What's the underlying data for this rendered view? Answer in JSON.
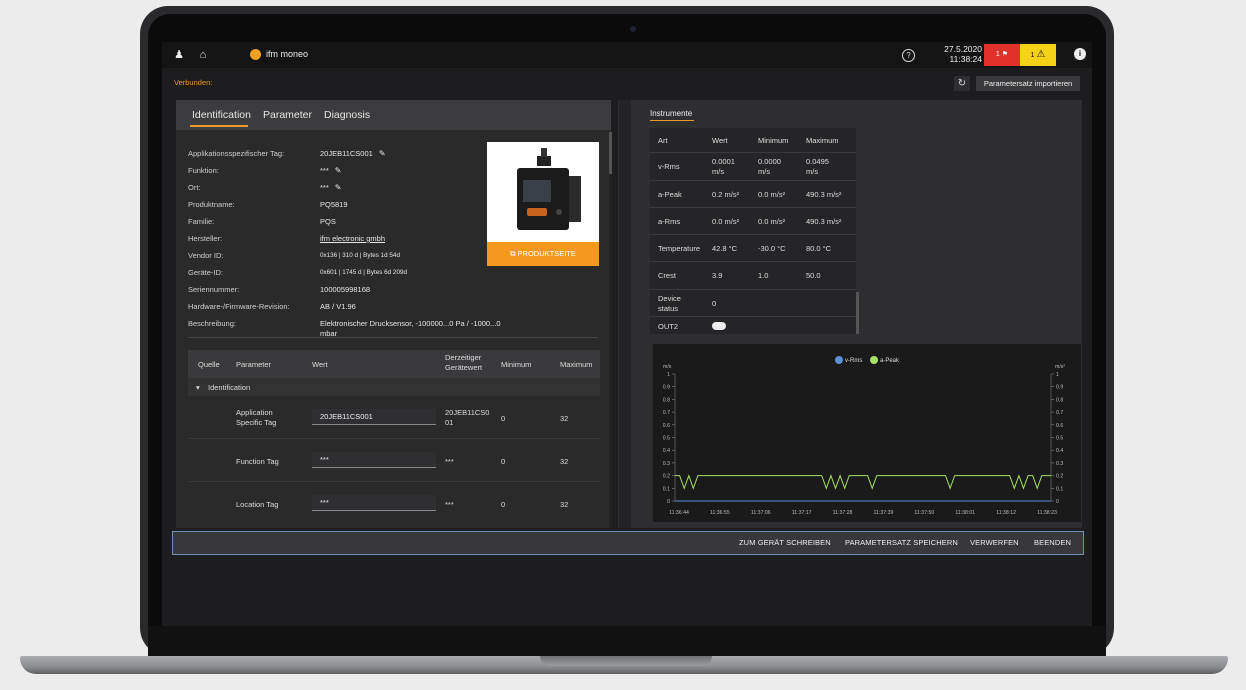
{
  "header": {
    "app_name": "ifm moneo",
    "date": "27.5.2020",
    "time": "11:38:24",
    "alarm_red_count": "1",
    "alarm_yellow_count": "1",
    "help_icon": "question-icon",
    "info_icon": "info-icon"
  },
  "status": {
    "connected": "Verbunden:",
    "import_label": "Parametersatz importieren"
  },
  "tabs": [
    "Identification",
    "Parameter",
    "Diagnosis"
  ],
  "identification": {
    "fields": [
      {
        "label": "Applikationsspezifischer Tag:",
        "value": "20JEB11CS001"
      },
      {
        "label": "Funktion:",
        "value": "***"
      },
      {
        "label": "Ort:",
        "value": "***"
      },
      {
        "label": "Produktname:",
        "value": "PQ5819"
      },
      {
        "label": "Familie:",
        "value": "PQS"
      },
      {
        "label": "Hersteller:",
        "value": "ifm electronic gmbh"
      },
      {
        "label": "Vendor ID:",
        "value": "0x136 | 310 d | Bytes 1d 54d"
      },
      {
        "label": "Geräte-ID:",
        "value": "0x601 | 1745 d | Bytes 6d 209d"
      },
      {
        "label": "Seriennummer:",
        "value": "100005998168"
      },
      {
        "label": "Hardware-/Firmware-Revision:",
        "value": "AB / V1.96"
      },
      {
        "label": "Beschreibung:",
        "value": "Elektronischer Drucksensor, -100000...0 Pa / -1000...0",
        "value2": "mbar"
      }
    ],
    "product_button": "PRODUKTSEITE"
  },
  "param_table": {
    "headers": [
      "Quelle",
      "Parameter",
      "Wert",
      "Derzeitiger",
      "Gerätewert",
      "Minimum",
      "Maximum"
    ],
    "group": "Identification",
    "rows": [
      {
        "param1": "Application",
        "param2": "Specific Tag",
        "value": "20JEB11CS001",
        "current1": "20JEB11CS0",
        "current2": "01",
        "min": "0",
        "max": "32"
      },
      {
        "param1": "Function Tag",
        "param2": "",
        "value": "***",
        "current1": "***",
        "current2": "",
        "min": "0",
        "max": "32"
      },
      {
        "param1": "Location Tag",
        "param2": "",
        "value": "***",
        "current1": "***",
        "current2": "",
        "min": "0",
        "max": "32"
      }
    ]
  },
  "instruments": {
    "title": "Instrumente",
    "headers": [
      "Art",
      "Wert",
      "Minimum",
      "Maximum"
    ],
    "rows": [
      {
        "art1": "v-Rms",
        "art2": "",
        "w1": "0.0001",
        "w2": "m/s",
        "min1": "0.0000",
        "min2": "m/s",
        "max1": "0.0495",
        "max2": "m/s"
      },
      {
        "art1": "a-Peak",
        "art2": "",
        "w1": "0.2 m/s²",
        "w2": "",
        "min1": "0.0 m/s²",
        "min2": "",
        "max1": "490.3 m/s²",
        "max2": ""
      },
      {
        "art1": "a-Rms",
        "art2": "",
        "w1": "0.0 m/s²",
        "w2": "",
        "min1": "0.0 m/s²",
        "min2": "",
        "max1": "490.3 m/s²",
        "max2": ""
      },
      {
        "art1": "Temperature",
        "art2": "",
        "w1": "42.8 °C",
        "w2": "",
        "min1": "-30.0 °C",
        "min2": "",
        "max1": "80.0 °C",
        "max2": ""
      },
      {
        "art1": "Crest",
        "art2": "",
        "w1": "3.9",
        "w2": "",
        "min1": "1.0",
        "min2": "",
        "max1": "50.0",
        "max2": ""
      },
      {
        "art1": "Device",
        "art2": "status",
        "w1": "0",
        "w2": "",
        "min1": "",
        "min2": "",
        "max1": "",
        "max2": ""
      },
      {
        "art1": "OUT2",
        "art2": "",
        "w1": "",
        "w2": "",
        "min1": "",
        "min2": "",
        "max1": "",
        "max2": ""
      }
    ],
    "out2_toggle": "on"
  },
  "chart_data": {
    "type": "line",
    "legend": [
      "v-Rms",
      "a-Peak"
    ],
    "colors": {
      "v-Rms": "#5b8fd6",
      "a-Peak": "#a8e063"
    },
    "y_left_label": "m/s",
    "y_right_label": "m/s²",
    "y_ticks": [
      "1",
      "0.9",
      "0.8",
      "0.7",
      "0.6",
      "0.5",
      "0.4",
      "0.3",
      "0.2",
      "0.1",
      "0"
    ],
    "ylim": [
      0,
      1
    ],
    "x_ticks": [
      "11:36:44",
      "11:36:55",
      "11:37:06",
      "11:37:17",
      "11:37:28",
      "11:37:39",
      "11:37:50",
      "11:38:01",
      "11:38:12",
      "11:38:23"
    ],
    "series": [
      {
        "name": "a-Peak",
        "values": [
          0.2,
          0.2,
          0.1,
          0.2,
          0.1,
          0.2,
          0.2,
          0.2,
          0.2,
          0.2,
          0.2,
          0.2,
          0.2,
          0.2,
          0.2,
          0.2,
          0.2,
          0.2,
          0.2,
          0.2,
          0.2,
          0.2,
          0.2,
          0.2,
          0.2,
          0.2,
          0.2,
          0.2,
          0.2,
          0.2,
          0.2,
          0.2,
          0.2,
          0.1,
          0.2,
          0.1,
          0.2,
          0.1,
          0.2,
          0.2,
          0.2,
          0.2,
          0.2,
          0.1,
          0.2,
          0.2,
          0.2,
          0.2,
          0.2,
          0.2,
          0.2,
          0.2,
          0.2,
          0.2,
          0.2,
          0.2,
          0.2,
          0.2,
          0.2,
          0.2,
          0.1,
          0.2,
          0.2,
          0.2,
          0.2,
          0.2,
          0.2,
          0.2,
          0.2,
          0.2,
          0.2,
          0.2,
          0.2,
          0.2,
          0.1,
          0.2,
          0.1,
          0.2,
          0.2,
          0.1,
          0.2,
          0.2,
          0.2
        ]
      },
      {
        "name": "v-Rms",
        "values": [
          0.0001,
          0.0001,
          0.0001,
          0.0001,
          0.0001,
          0.0001,
          0.0001,
          0.0001,
          0.0001,
          0.0001,
          0.0001,
          0.0001,
          0.0001,
          0.0001,
          0.0001,
          0.0001,
          0.0001,
          0.0001,
          0.0001,
          0.0001
        ]
      }
    ]
  },
  "actions": [
    "ZUM GERÄT SCHREIBEN",
    "PARAMETERSATZ SPEICHERN",
    "VERWERFEN",
    "BEENDEN"
  ]
}
